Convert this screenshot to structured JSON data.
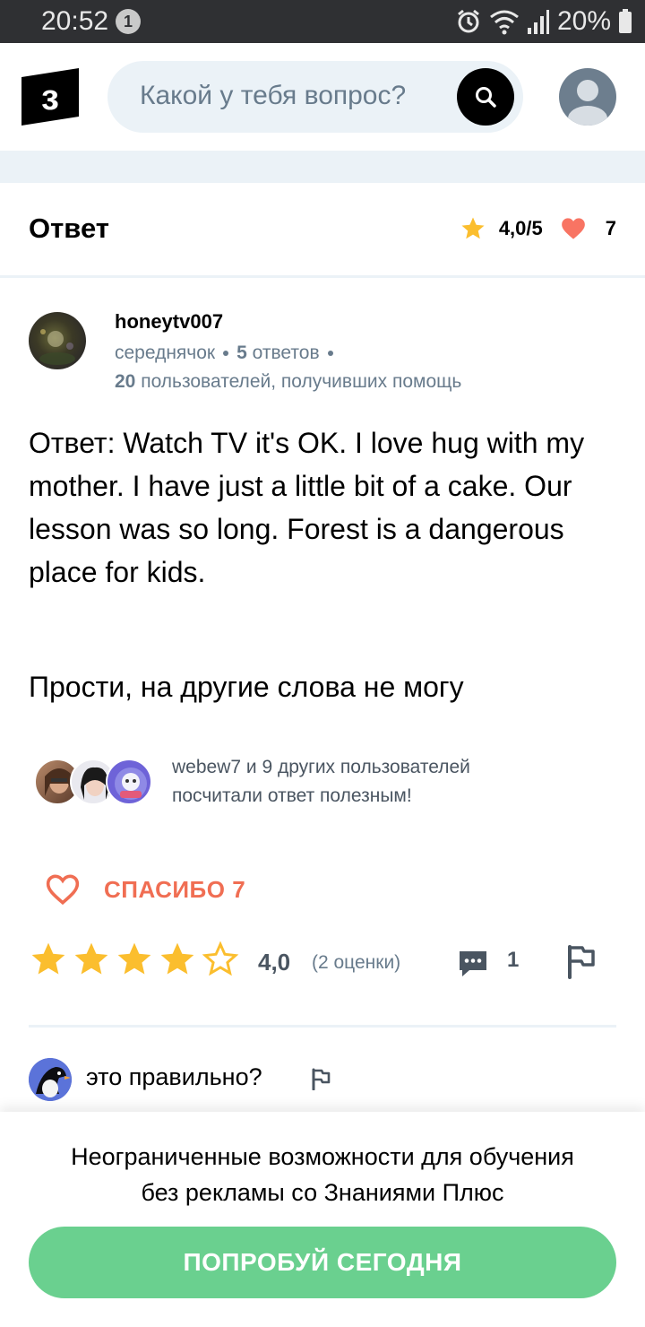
{
  "status_bar": {
    "time": "20:52",
    "notification_count": "1",
    "battery": "20%",
    "icons": [
      "alarm-icon",
      "wifi-icon",
      "signal-icon",
      "battery-icon"
    ]
  },
  "header": {
    "logo_letter": "з",
    "search_placeholder": "Какой у тебя вопрос?",
    "icons": [
      "search-icon",
      "user-avatar-icon"
    ]
  },
  "answer": {
    "title": "Ответ",
    "rating": "4,0/5",
    "likes": "7",
    "author": {
      "name": "honeytv007",
      "rank": "середнячок",
      "answers_count": "5",
      "answers_label": "ответов",
      "helped_count": "20",
      "helped_label": "пользователей, получивших помощь"
    },
    "text": "Ответ: Watch TV it's OK. I love hug with my mother. I have just a little bit of a cake. Our lesson was so long. Forest is a dangerous place for kids.",
    "text2": "Прости, на другие слова не могу",
    "helpful_line1": "webew7 и 9 других пользователей",
    "helpful_line2": "посчитали ответ полезным!",
    "thanks_label": "СПАСИБО 7",
    "stars_filled": 4,
    "stars_total": 5,
    "rating_value": "4,0",
    "rating_count": "(2 оценки)",
    "comments_count": "1"
  },
  "comment": {
    "text": "это правильно?"
  },
  "promo": {
    "line1": "Неограниченные возможности для обучения",
    "line2": "без рекламы со Знаниями Плюс",
    "button": "ПОПРОБУЙ СЕГОДНЯ"
  },
  "colors": {
    "accent_green": "#6ad08f",
    "thanks_red": "#f06e53",
    "star_yellow": "#fbbe2e",
    "muted": "#687b8c",
    "light_blue": "#ebf2f7"
  }
}
